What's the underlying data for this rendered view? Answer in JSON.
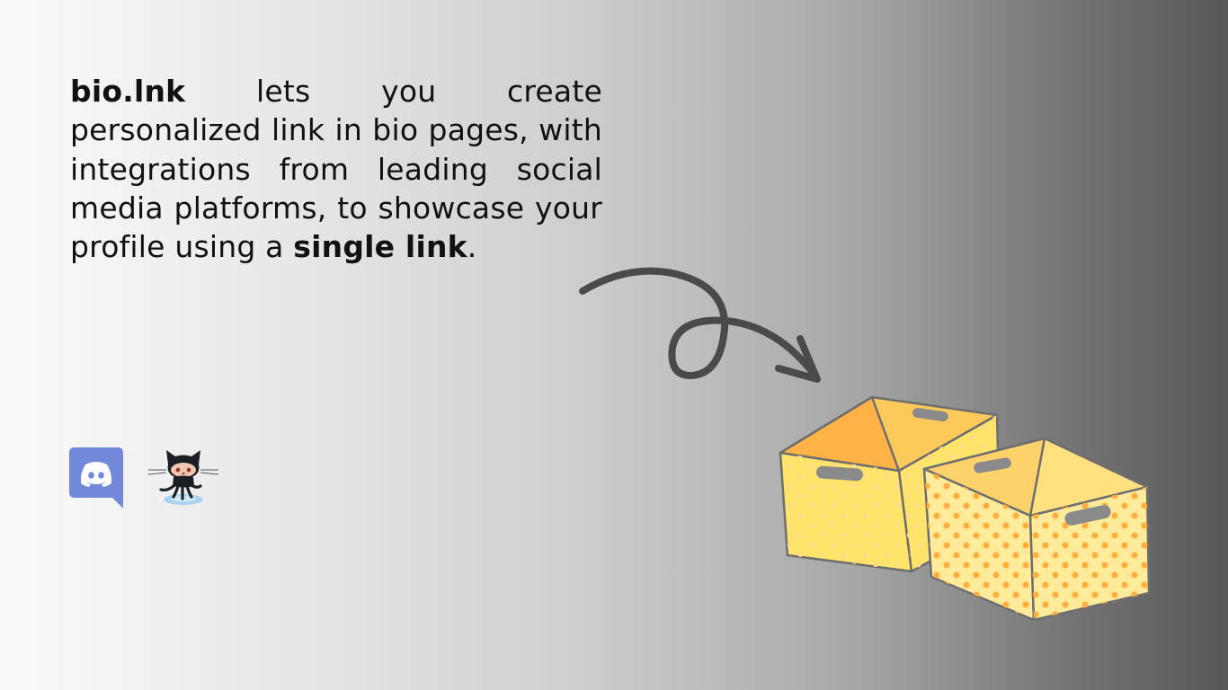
{
  "blurb": {
    "brand": "bio.lnk",
    "text_part1": " lets you create personalized link in bio pages, with integrations from leading social media platforms, to showcase your profile using a ",
    "highlight": "single link",
    "text_end": "."
  },
  "social_links": [
    {
      "name": "Discord",
      "icon": "discord-icon",
      "color": "#7289DA"
    },
    {
      "name": "GitHub",
      "icon": "github-octocat-icon",
      "color": "#24292e"
    }
  ],
  "colors": {
    "text": "#111111",
    "arrow": "#4a4a4a",
    "box_yellow": "#FFE265",
    "box_orange": "#FFB74A",
    "box_light": "#FFEB99",
    "box_outline": "#6e6e6e"
  }
}
